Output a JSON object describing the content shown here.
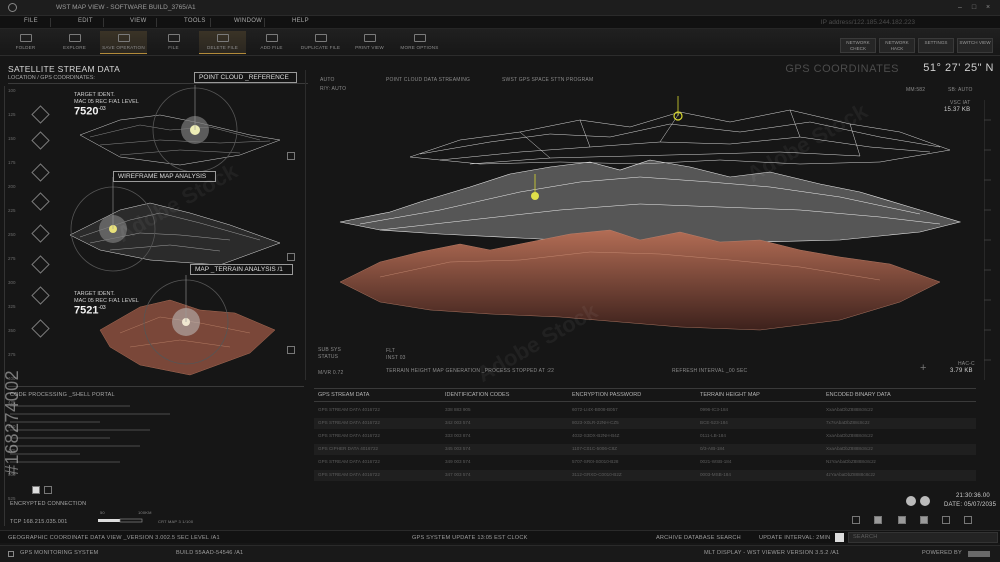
{
  "window": {
    "title": "WST MAP VIEW - SOFTWARE BUILD_3765/A1",
    "controls": [
      "–",
      "□",
      "×"
    ]
  },
  "menu": {
    "items": [
      "FILE",
      "EDIT",
      "VIEW",
      "TOOLS",
      "WINDOW",
      "HELP"
    ],
    "ip_address": "IP address/122.185.244.182.223"
  },
  "toolbar": {
    "tools": [
      {
        "label": "FOLDER",
        "icon": "folder-icon"
      },
      {
        "label": "EXPLORE",
        "icon": "explore-icon"
      },
      {
        "label": "SAVE OPERATION",
        "icon": "save-icon",
        "active": true
      },
      {
        "label": "FILE",
        "icon": "file-icon"
      },
      {
        "label": "DELETE FILE",
        "icon": "delete-icon",
        "active": true
      },
      {
        "label": "ADD FILE",
        "icon": "add-file-icon"
      },
      {
        "label": "DUPLICATE FILE",
        "icon": "duplicate-icon"
      },
      {
        "label": "PRINT VIEW",
        "icon": "print-icon"
      },
      {
        "label": "MORE OPTIONS",
        "icon": "more-icon"
      }
    ],
    "right_buttons": [
      "NETWORK CHECK",
      "NETWORK HACK",
      "SETTINGS",
      "SWITCH VIEW"
    ]
  },
  "left_panel": {
    "title": "SATELLITE STREAM DATA",
    "subtitle": "LOCATION / GPS COORDINATES:",
    "ruler_ticks": [
      "100",
      "125",
      "150",
      "175",
      "200",
      "225",
      "250",
      "275",
      "300",
      "325",
      "350",
      "375",
      "400",
      "425",
      "450",
      "475",
      "500",
      "525"
    ],
    "target1": {
      "line1": "TARGET IDENT.",
      "line2": "MAC 05 REC F/A1 LEVEL",
      "value": "7520",
      "sup": "-03"
    },
    "target2": {
      "line1": "TARGET IDENT.",
      "line2": "MAC 05 REC F/A1 LEVEL",
      "value": "7521",
      "sup": "-03"
    },
    "labels": [
      "POINT CLOUD _REFERENCE",
      "WIREFRAME MAP ANALYSIS",
      "MAP _TERRAIN ANALYSIS /1"
    ]
  },
  "main_view": {
    "coord_header": "GPS COORDINATES",
    "coord_value": "51° 27' 25\" N",
    "auto": "AUTO",
    "ry": "R/Y: AUTO",
    "stream": "POINT CLOUD DATA STREAMING",
    "program": "SWST GPS SPACE STTN PROGRAM",
    "mm": "MM:582",
    "sb": "SB: AUTO",
    "vsc": "VSC IAT",
    "size1": "15.37 KB",
    "sub_sys": "SUB SYS",
    "status": "STATUS",
    "flt": "FLT",
    "inst": "INST 03",
    "mvr": "M/VR 0.72",
    "terrain_msg": "TERRAIN HEIGHT MAP GENERATION _PROCESS STOPPED AT :22",
    "refresh": "REFRESH INTERVAL _00 SEC",
    "hac": "HAC-C",
    "size2": "3.79 KB"
  },
  "code_panel": {
    "title": "CODE PROCESSING _SHELL PORTAL"
  },
  "table": {
    "headers": [
      "GPS STREAM DATA",
      "IDENTIFICATION CODES",
      "ENCRYPTION PASSWORD",
      "TERRAIN HEIGHT MAP",
      "ENCODED BINARY DATA"
    ],
    "rows": [
      [
        "GPS STREAM DATA 4016722",
        "338 883 905",
        "6072-LI4X-B008-B057",
        "0996-IC3-184",
        "XxaAbaDbZ8888c8c2z"
      ],
      [
        "GPS STREAM DATA 4016722",
        "342 003 574",
        "8023-X0LR-22NH-CZ5",
        "BCE-523-184",
        "7x7sAbaDbZ88c8c2z"
      ],
      [
        "GPS STREAM DATA 4016722",
        "333 003 874",
        "4032-S3DX-B2NH-B4Z",
        "0111-LB-184",
        "XxaAbaDbZ8888c8c2z"
      ],
      [
        "GPS CIPHER DATA 4016722",
        "345 003 574",
        "1107-C01C-5006-C8Z",
        "0/3-AIB-184",
        "XxaAbaDbZ8888c8c2z"
      ],
      [
        "GPS STREAM DATA 4016722",
        "349 003 574",
        "5707-SR0I-S0010-B28",
        "0021-WSB-184",
        "NzYaAbaDbZ8888c8c2z"
      ],
      [
        "GPS STREAM DATA 4016722",
        "347 003 574",
        "3112-GRXD-C0010-B2Z",
        "0003-MSB-184",
        "4zYaAbaDbZ8888c8c2z"
      ]
    ]
  },
  "bottom_left": {
    "conn": "ENCRYPTED CONNECTION",
    "tcp": "TCP 168.215.035.001",
    "scale_labels": [
      "50",
      "100KM",
      "CRT MAP 3 1/100"
    ]
  },
  "clock": {
    "time": "21:30:36.00",
    "date": "DATE: 05/07/2035"
  },
  "status_bar_1": {
    "left": "GEOGRAPHIC COORDINATE DATA VIEW _VERSION 3.002.5 SEC LEVEL /A1",
    "center": "GPS SYSTEM UPDATE 13:05 EST CLOCK",
    "archive": "ARCHIVE DATABASE SEARCH",
    "interval": "UPDATE INTERVAL: 2MIN",
    "search": "SEARCH"
  },
  "status_bar_2": {
    "left": "GPS MONITORING SYSTEM",
    "build": "BUILD 55AAD-54546 /A1",
    "center": "MLT DISPLAY - WST VIEWER VERSION 3.5.2 /A1",
    "powered": "POWERED BY"
  },
  "stock": {
    "id": "#168274002",
    "watermark": "Adobe Stock"
  },
  "colors": {
    "terrain": "#9a5a45",
    "wireframe": "#e6e6e6",
    "accent": "#d8d830",
    "active_tool": "#b38b3a"
  }
}
